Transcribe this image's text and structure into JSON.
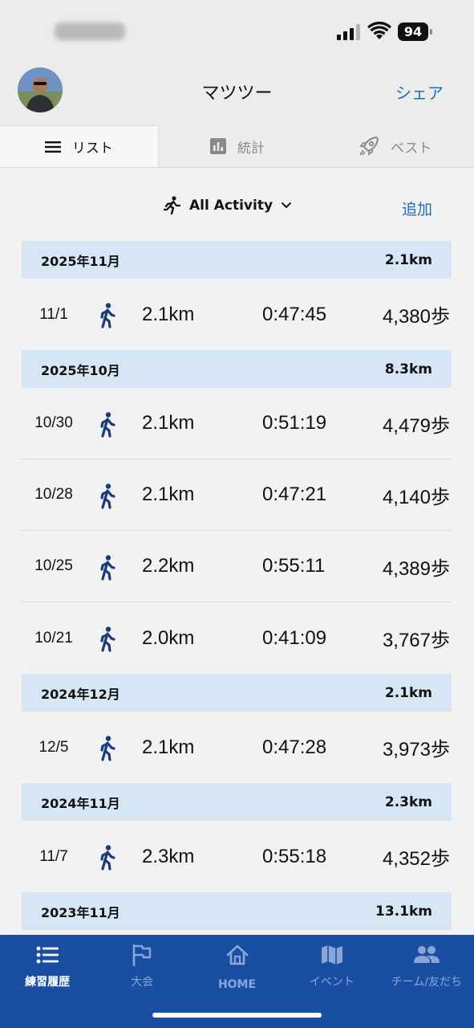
{
  "status_bar": {
    "battery": "94"
  },
  "header": {
    "title": "マツツー",
    "share_label": "シェア"
  },
  "tabs": [
    {
      "label": "リスト",
      "icon": "list-icon"
    },
    {
      "label": "統計",
      "icon": "bar-chart-icon"
    },
    {
      "label": "ベスト",
      "icon": "rocket-icon"
    }
  ],
  "filter": {
    "label": "All Activity",
    "add_label": "追加"
  },
  "months": [
    {
      "label": "2025年11月",
      "total": "2.1km"
    },
    {
      "label": "2025年10月",
      "total": "8.3km"
    },
    {
      "label": "2024年12月",
      "total": "2.1km"
    },
    {
      "label": "2024年11月",
      "total": "2.3km"
    },
    {
      "label": "2023年11月",
      "total": "13.1km"
    }
  ],
  "activities": [
    {
      "date": "11/1",
      "distance": "2.1km",
      "duration": "0:47:45",
      "steps": "4,380歩"
    },
    {
      "date": "10/30",
      "distance": "2.1km",
      "duration": "0:51:19",
      "steps": "4,479歩"
    },
    {
      "date": "10/28",
      "distance": "2.1km",
      "duration": "0:47:21",
      "steps": "4,140歩"
    },
    {
      "date": "10/25",
      "distance": "2.2km",
      "duration": "0:55:11",
      "steps": "4,389歩"
    },
    {
      "date": "10/21",
      "distance": "2.0km",
      "duration": "0:41:09",
      "steps": "3,767歩"
    },
    {
      "date": "12/5",
      "distance": "2.1km",
      "duration": "0:47:28",
      "steps": "3,973歩"
    },
    {
      "date": "11/7",
      "distance": "2.3km",
      "duration": "0:55:18",
      "steps": "4,352歩"
    }
  ],
  "tabbar": [
    {
      "label": "練習履歴",
      "icon": "list-icon"
    },
    {
      "label": "大会",
      "icon": "flag-icon"
    },
    {
      "label": "HOME",
      "icon": "home-icon"
    },
    {
      "label": "イベント",
      "icon": "map-icon"
    },
    {
      "label": "チーム/友だち",
      "icon": "people-icon"
    }
  ],
  "colors": {
    "accent": "#1e6fb5",
    "month_header": "#d6e6f5",
    "tabbar": "#1a4ea3",
    "walker_icon": "#1b3a7a"
  }
}
